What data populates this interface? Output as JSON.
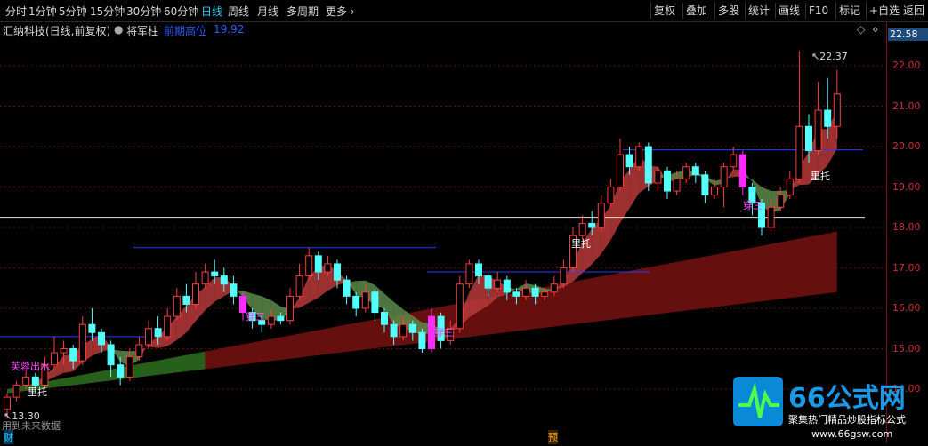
{
  "toolbar": {
    "periods": [
      "分时",
      "1分钟",
      "5分钟",
      "15分钟",
      "30分钟",
      "60分钟",
      "日线",
      "周线",
      "月线",
      "多周期",
      "更多"
    ],
    "active_period": "日线",
    "right_buttons": [
      "复权",
      "叠加",
      "多股",
      "统计",
      "画线",
      "F10",
      "标记",
      "+自选",
      "返回"
    ]
  },
  "info": {
    "stock": "汇纳科技(日线,前复权)",
    "indicator": "将军柱",
    "label": "前期高位",
    "value": "19.92",
    "diamond_icon": "◇"
  },
  "axis": {
    "ticks": [
      "22.00",
      "21.00",
      "20.00",
      "19.00",
      "18.00",
      "17.00",
      "16.00",
      "15.00",
      "14.00"
    ],
    "current_price": "22.58"
  },
  "annotations": {
    "high_price": "22.37",
    "low_price": "13.30",
    "signals": [
      "芙蓉出水",
      "里托",
      "穿三",
      "穿三",
      "里托",
      "穿三",
      "里托"
    ],
    "footer_left": "用到未来数据",
    "footer_mark_cai": "财",
    "footer_mark_yu": "预"
  },
  "watermark": {
    "brand": "66公式网",
    "tagline": "聚集热门精品炒股指标公式",
    "url": "www.66gsw.com"
  },
  "colors": {
    "up": "#ff3c3c",
    "down": "#54ffff",
    "ribbon_red": "#b83a3a",
    "ribbon_green": "#5c8a4a",
    "band_dark": "#6a1010",
    "band_green": "#2a6a1e",
    "blue_line": "#2a3cff",
    "accent": "#2ec8ff"
  },
  "chart_data": {
    "type": "candlestick",
    "y_range": [
      13.0,
      22.8
    ],
    "horizontal_levels": [
      19.92,
      18.25
    ],
    "candles": [
      [
        13.5,
        13.8,
        13.3,
        13.9
      ],
      [
        13.8,
        14.1,
        13.7,
        14.2
      ],
      [
        14.1,
        14.3,
        14.0,
        14.5
      ],
      [
        14.3,
        14.1,
        13.9,
        14.4
      ],
      [
        14.1,
        14.6,
        14.0,
        14.8
      ],
      [
        14.6,
        14.9,
        14.5,
        15.3
      ],
      [
        14.9,
        15.0,
        14.6,
        15.2
      ],
      [
        15.0,
        14.7,
        14.5,
        15.1
      ],
      [
        14.7,
        15.6,
        14.6,
        15.8
      ],
      [
        15.6,
        15.4,
        15.2,
        16.0
      ],
      [
        15.4,
        15.1,
        14.9,
        15.5
      ],
      [
        15.1,
        14.6,
        14.3,
        15.2
      ],
      [
        14.6,
        14.3,
        14.1,
        14.8
      ],
      [
        14.3,
        14.8,
        14.2,
        15.0
      ],
      [
        14.8,
        15.1,
        14.7,
        15.3
      ],
      [
        15.1,
        15.5,
        15.0,
        15.7
      ],
      [
        15.5,
        15.3,
        15.1,
        15.8
      ],
      [
        15.3,
        15.8,
        15.2,
        16.0
      ],
      [
        15.8,
        16.3,
        15.7,
        16.5
      ],
      [
        16.3,
        16.1,
        15.9,
        16.6
      ],
      [
        16.1,
        16.6,
        16.0,
        16.9
      ],
      [
        16.6,
        16.9,
        16.5,
        17.1
      ],
      [
        16.9,
        16.8,
        16.6,
        17.2
      ],
      [
        16.8,
        16.6,
        16.4,
        17.0
      ],
      [
        16.6,
        16.3,
        16.1,
        16.8
      ],
      [
        16.3,
        15.9,
        15.7,
        16.4
      ],
      [
        15.9,
        15.7,
        15.5,
        16.0
      ],
      [
        15.7,
        15.6,
        15.4,
        15.8
      ],
      [
        15.6,
        15.8,
        15.5,
        16.0
      ],
      [
        15.8,
        15.7,
        15.6,
        15.9
      ],
      [
        15.7,
        16.3,
        15.6,
        16.5
      ],
      [
        16.3,
        16.8,
        16.2,
        17.1
      ],
      [
        16.8,
        17.3,
        16.7,
        17.5
      ],
      [
        17.3,
        16.9,
        16.7,
        17.4
      ],
      [
        16.9,
        17.1,
        16.8,
        17.3
      ],
      [
        17.1,
        16.7,
        16.5,
        17.2
      ],
      [
        16.7,
        16.3,
        16.1,
        16.8
      ],
      [
        16.3,
        16.0,
        15.8,
        16.4
      ],
      [
        16.0,
        16.4,
        15.9,
        16.6
      ],
      [
        16.4,
        15.9,
        15.7,
        16.5
      ],
      [
        15.9,
        15.6,
        15.4,
        16.0
      ],
      [
        15.6,
        15.3,
        15.1,
        15.7
      ],
      [
        15.3,
        15.6,
        15.2,
        15.8
      ],
      [
        15.6,
        15.4,
        15.2,
        15.7
      ],
      [
        15.4,
        15.0,
        14.9,
        15.5
      ],
      [
        15.0,
        15.8,
        14.9,
        16.0
      ],
      [
        15.8,
        15.2,
        15.0,
        15.9
      ],
      [
        15.2,
        15.5,
        15.1,
        15.7
      ],
      [
        15.5,
        16.6,
        15.4,
        16.8
      ],
      [
        16.6,
        17.1,
        16.5,
        17.2
      ],
      [
        17.1,
        16.8,
        16.6,
        17.2
      ],
      [
        16.8,
        16.5,
        16.3,
        16.9
      ],
      [
        16.5,
        16.7,
        16.4,
        16.9
      ],
      [
        16.7,
        16.4,
        16.2,
        16.8
      ],
      [
        16.4,
        16.3,
        16.1,
        16.5
      ],
      [
        16.3,
        16.5,
        16.2,
        16.7
      ],
      [
        16.5,
        16.3,
        16.1,
        16.6
      ],
      [
        16.3,
        16.4,
        16.2,
        16.5
      ],
      [
        16.4,
        16.6,
        16.3,
        16.8
      ],
      [
        16.6,
        17.0,
        16.5,
        17.2
      ],
      [
        17.0,
        17.8,
        16.9,
        18.0
      ],
      [
        17.8,
        18.1,
        17.7,
        18.3
      ],
      [
        18.1,
        18.0,
        17.8,
        18.4
      ],
      [
        18.0,
        18.6,
        17.9,
        18.8
      ],
      [
        18.6,
        19.0,
        18.5,
        19.2
      ],
      [
        19.0,
        19.8,
        18.9,
        20.2
      ],
      [
        19.8,
        19.5,
        19.3,
        20.0
      ],
      [
        19.5,
        20.0,
        19.4,
        20.1
      ],
      [
        20.0,
        19.1,
        18.9,
        20.1
      ],
      [
        19.1,
        19.4,
        18.9,
        19.5
      ],
      [
        19.4,
        18.9,
        18.7,
        19.5
      ],
      [
        18.9,
        19.2,
        18.8,
        19.4
      ],
      [
        19.2,
        19.5,
        19.1,
        19.6
      ],
      [
        19.5,
        19.3,
        19.1,
        19.6
      ],
      [
        19.3,
        18.8,
        18.6,
        19.4
      ],
      [
        18.8,
        19.0,
        18.7,
        19.2
      ],
      [
        19.0,
        19.5,
        18.5,
        19.6
      ],
      [
        19.5,
        19.8,
        19.4,
        20.0
      ],
      [
        19.8,
        19.0,
        18.8,
        19.9
      ],
      [
        19.0,
        18.6,
        18.3,
        19.1
      ],
      [
        18.6,
        18.0,
        17.8,
        18.7
      ],
      [
        18.0,
        18.5,
        17.9,
        18.7
      ],
      [
        18.5,
        18.8,
        18.4,
        19.0
      ],
      [
        18.8,
        19.2,
        18.7,
        19.4
      ],
      [
        19.2,
        20.5,
        19.1,
        22.37
      ],
      [
        20.5,
        19.9,
        19.6,
        20.8
      ],
      [
        19.9,
        20.9,
        19.8,
        21.6
      ],
      [
        20.9,
        20.5,
        20.2,
        21.7
      ],
      [
        20.5,
        21.3,
        20.2,
        21.9
      ]
    ]
  }
}
